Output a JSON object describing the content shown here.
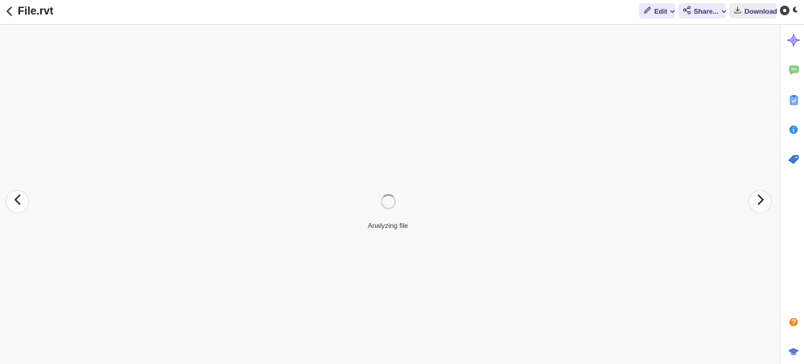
{
  "header": {
    "title": "File.rvt",
    "edit_label": "Edit",
    "share_label": "Share...",
    "download_label": "Download"
  },
  "main": {
    "status_text": "Analyzing file"
  },
  "sidebar": {
    "icons": [
      "sparkle-icon",
      "chat-icon",
      "clipboard-icon",
      "info-icon",
      "tag-icon",
      "help-icon",
      "graduation-cap-icon"
    ]
  },
  "colors": {
    "accent_bg": "#ece9fb",
    "accent_text": "#3b2f6b",
    "page_bg": "#f9f9f9"
  }
}
